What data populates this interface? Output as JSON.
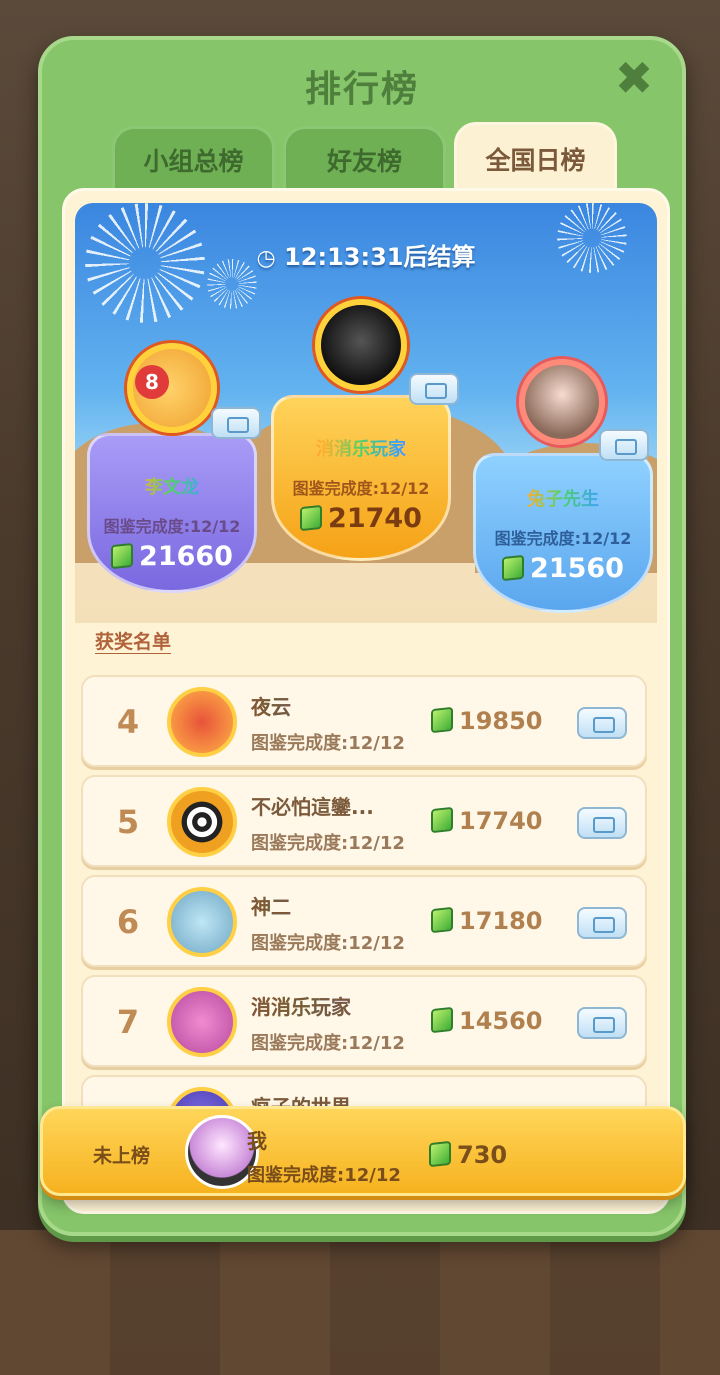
{
  "header": {
    "title": "排行榜",
    "close_icon": "close-icon"
  },
  "tabs": [
    {
      "label": "小组总榜",
      "active": false
    },
    {
      "label": "好友榜",
      "active": false
    },
    {
      "label": "全国日榜",
      "active": true
    }
  ],
  "timer": {
    "icon": "clock-icon",
    "text": "12:13:31后结算"
  },
  "podium": [
    {
      "place": 2,
      "name": "李文龙",
      "completion": "图鉴完成度:12/12",
      "score": "21660",
      "badge": "8",
      "color": "#8f7fee"
    },
    {
      "place": 1,
      "name": "消消乐玩家",
      "completion": "图鉴完成度:12/12",
      "score": "21740",
      "color": "#f7ae22"
    },
    {
      "place": 3,
      "name": "兔子先生",
      "completion": "图鉴完成度:12/12",
      "score": "21560",
      "color": "#6cb5f2"
    }
  ],
  "prize_list_label": "获奖名单",
  "rows": [
    {
      "rank": "4",
      "name": "夜云",
      "completion": "图鉴完成度:12/12",
      "score": "19850"
    },
    {
      "rank": "5",
      "name": "不必怕這鑾...",
      "completion": "图鉴完成度:12/12",
      "score": "17740"
    },
    {
      "rank": "6",
      "name": "神二",
      "completion": "图鉴完成度:12/12",
      "score": "17180"
    },
    {
      "rank": "7",
      "name": "消消乐玩家",
      "completion": "图鉴完成度:12/12",
      "score": "14560"
    },
    {
      "rank": "",
      "name": "疯子的世界...",
      "completion": "",
      "score": ""
    }
  ],
  "me": {
    "label": "未上榜",
    "name": "我",
    "completion": "图鉴完成度:12/12",
    "score": "730"
  },
  "colors": {
    "panel": "#86c56a",
    "accent": "#f6b21f",
    "gem": "#3fae37"
  }
}
